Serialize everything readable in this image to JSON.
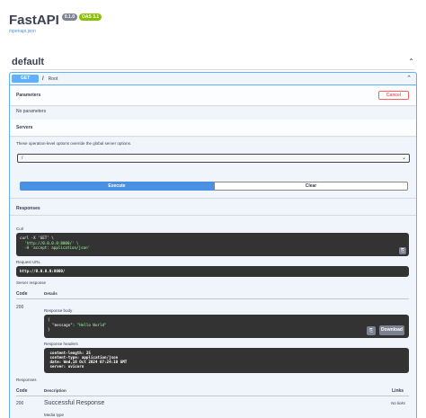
{
  "app": {
    "title": "FastAPI",
    "version_badge": "0.1.0",
    "oas_badge": "OAS 3.1",
    "openapi_link": "/openapi.json"
  },
  "tag": {
    "name": "default"
  },
  "operation": {
    "method": "GET",
    "path": "/",
    "summary": "Root"
  },
  "parameters": {
    "title": "Parameters",
    "cancel_label": "Cancel",
    "empty_text": "No parameters"
  },
  "servers": {
    "title": "Servers",
    "description": "These operation-level options override the global server options.",
    "selected": "/"
  },
  "actions": {
    "execute_label": "Execute",
    "clear_label": "Clear"
  },
  "responses_live": {
    "title": "Responses",
    "curl_label": "Curl",
    "curl_line1": "curl -X 'GET' \\",
    "curl_line2": "  'http://0.0.0.0:8000/' \\",
    "curl_line3": "  -H 'accept: application/json'",
    "request_url_label": "Request URL",
    "request_url": "http://0.0.0.0:8000/",
    "server_response_label": "Server response",
    "code_header": "Code",
    "details_header": "Details",
    "code": "200",
    "body_label": "Response body",
    "body_line1": "{",
    "body_key": "  \"message\": ",
    "body_value": "\"Hello World\"",
    "body_line3": "}",
    "download_label": "Download",
    "headers_label": "Response headers",
    "header_line1": " content-length: 25",
    "header_line2": " content-type: application/json",
    "header_line3": " date: Wed,16 Oct 2024 07:24:10 GMT",
    "header_line4": " server: uvicorn"
  },
  "responses_doc": {
    "title": "Responses",
    "code_header": "Code",
    "description_header": "Description",
    "links_header": "Links",
    "code": "200",
    "description": "Successful Response",
    "links_value": "No links",
    "media_type_label": "Media type"
  },
  "colors": {
    "get_blue": "#61affe",
    "execute_blue": "#4990e2",
    "cancel_red": "#ff6060",
    "oas_green": "#89bf04"
  },
  "icons": [
    "chevron-up-icon",
    "copy-icon",
    "select-arrow-icon"
  ]
}
